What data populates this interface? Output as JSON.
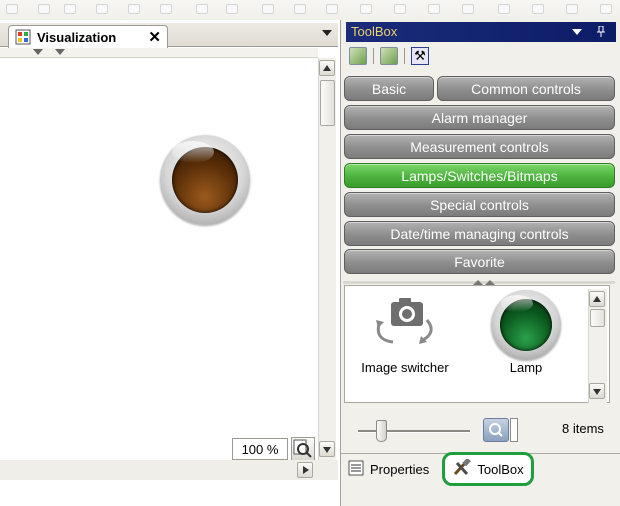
{
  "document": {
    "tab_title": "Visualization",
    "close_glyph": "✕",
    "zoom_level": "100 %"
  },
  "toolbox": {
    "title": "ToolBox",
    "categories_row1": [
      "Basic",
      "Common controls"
    ],
    "categories": [
      "Alarm manager",
      "Measurement controls",
      "Lamps/Switches/Bitmaps",
      "Special controls",
      "Date/time managing controls",
      "Favorite"
    ],
    "active_category": "Lamps/Switches/Bitmaps",
    "items": [
      {
        "label": "Image switcher",
        "icon": "camera-cycle-icon"
      },
      {
        "label": "Lamp",
        "icon": "green-lamp-icon"
      }
    ],
    "items_count": "8 items",
    "zoom_slider_fraction": 0.18
  },
  "bottom_tabs": [
    {
      "label": "Properties",
      "icon": "properties-icon"
    },
    {
      "label": "ToolBox",
      "icon": "toolbox-icon"
    }
  ],
  "colors": {
    "active_category": "#4cb33d",
    "category": "#8e8e8e",
    "title_bar": "#1b2c7a",
    "title_text": "#e9d26a",
    "highlight": "#1e9e3c"
  }
}
